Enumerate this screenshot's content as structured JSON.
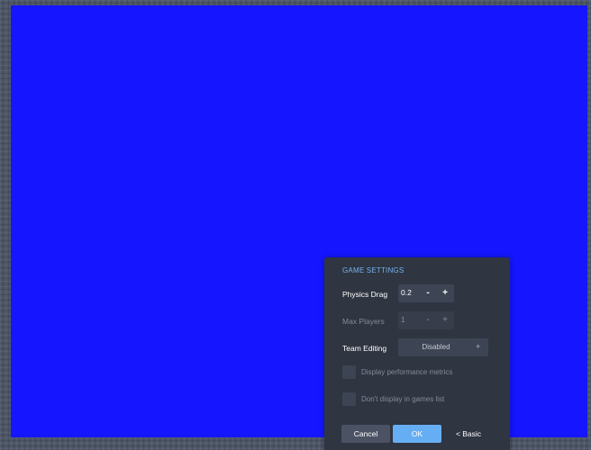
{
  "colors": {
    "canvas": "#1515ff",
    "panel_background": "#2f3541",
    "accent": "#66aef4",
    "title": "#79b2ee"
  },
  "settings": {
    "title": "GAME SETTINGS",
    "physics_drag": {
      "label": "Physics Drag",
      "value": "0.2",
      "decrement": "-",
      "increment": "+",
      "enabled": true
    },
    "max_players": {
      "label": "Max Players",
      "value": "1",
      "decrement": "-",
      "increment": "+",
      "enabled": false
    },
    "team_editing": {
      "label": "Team Editing",
      "value": "Disabled",
      "icon": "plus-icon",
      "arrow": "+"
    },
    "display_metrics": {
      "label": "Display performance metrics",
      "checked": false
    },
    "hide_from_list": {
      "label": "Don't display in games list",
      "checked": false
    }
  },
  "buttons": {
    "cancel": "Cancel",
    "ok": "OK",
    "basic": "< Basic"
  }
}
